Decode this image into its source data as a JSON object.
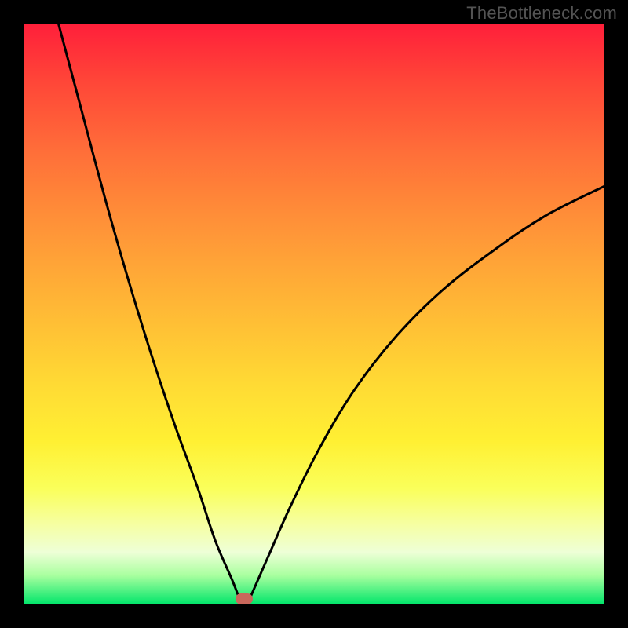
{
  "watermark": "TheBottleneck.com",
  "chart_data": {
    "type": "line",
    "title": "",
    "xlabel": "",
    "ylabel": "",
    "xlim": [
      0,
      100
    ],
    "ylim": [
      0,
      100
    ],
    "grid": false,
    "legend": false,
    "marker": {
      "x": 38,
      "y": 1,
      "color": "#c9675b"
    },
    "series": [
      {
        "name": "left-branch",
        "x": [
          6,
          10,
          14,
          18,
          22,
          26,
          30,
          33,
          36,
          37.5
        ],
        "values": [
          100,
          85,
          70,
          56,
          43,
          31,
          20,
          11,
          4,
          0
        ]
      },
      {
        "name": "right-branch",
        "x": [
          38.5,
          42,
          46,
          51,
          57,
          64,
          72,
          81,
          90,
          100
        ],
        "values": [
          0,
          8,
          17,
          27,
          37,
          46,
          54,
          61,
          67,
          72
        ]
      }
    ],
    "gradient_stops": [
      {
        "pos": 0,
        "color": "#ff1f3a"
      },
      {
        "pos": 10,
        "color": "#ff4638"
      },
      {
        "pos": 22,
        "color": "#ff6e39"
      },
      {
        "pos": 32,
        "color": "#ff8b38"
      },
      {
        "pos": 42,
        "color": "#ffa637"
      },
      {
        "pos": 52,
        "color": "#ffc035"
      },
      {
        "pos": 62,
        "color": "#ffda34"
      },
      {
        "pos": 72,
        "color": "#fff033"
      },
      {
        "pos": 80,
        "color": "#faff5a"
      },
      {
        "pos": 86,
        "color": "#f6ffa0"
      },
      {
        "pos": 91,
        "color": "#eeffd7"
      },
      {
        "pos": 95,
        "color": "#a9ff9f"
      },
      {
        "pos": 100,
        "color": "#00e56a"
      }
    ]
  }
}
